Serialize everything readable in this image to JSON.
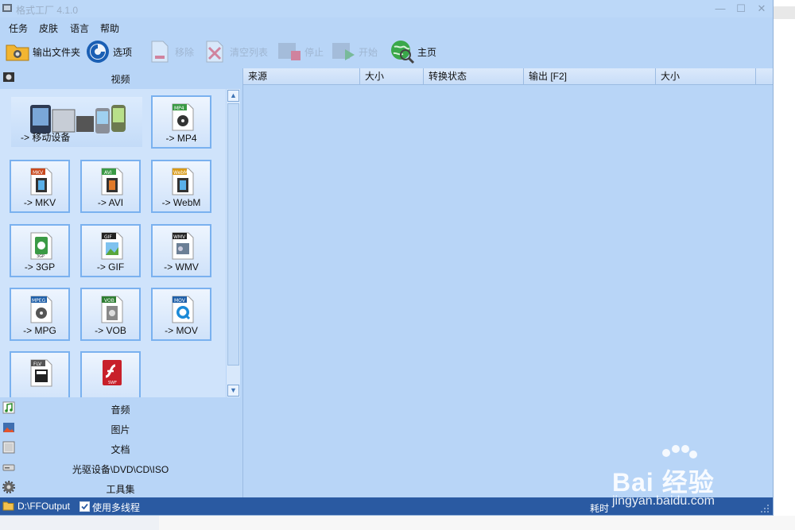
{
  "window": {
    "title": "格式工厂 4.1.0"
  },
  "menu": [
    "任务",
    "皮肤",
    "语言",
    "帮助"
  ],
  "toolbar": {
    "output_folder": "输出文件夹",
    "options": "选项",
    "remove": "移除",
    "clear_list": "清空列表",
    "stop": "停止",
    "start": "开始",
    "home": "主页"
  },
  "categories": {
    "video": "视频",
    "audio": "音频",
    "image": "图片",
    "document": "文档",
    "optical": "光驱设备\\DVD\\CD\\ISO",
    "tools": "工具集"
  },
  "tiles": {
    "mobile": "-> 移动设备",
    "mp4": "-> MP4",
    "mkv": "-> MKV",
    "avi": "-> AVI",
    "webm": "-> WebM",
    "3gp": "-> 3GP",
    "gif": "-> GIF",
    "wmv": "-> WMV",
    "mpg": "-> MPG",
    "vob": "-> VOB",
    "mov": "-> MOV"
  },
  "tile_badges": {
    "mp4": "MP4",
    "mkv": "MKV",
    "avi": "AVI",
    "webm": "WebM",
    "3gp": "3GP",
    "gif": "GIF",
    "wmv": "WMV",
    "mpeg": "MPEG",
    "vob": "VOB",
    "mov": "MOV",
    "flv": "FLV",
    "swf": "SWF"
  },
  "table": {
    "columns": [
      "来源",
      "大小",
      "转换状态",
      "输出 [F2]",
      "大小"
    ]
  },
  "status": {
    "output_path": "D:\\FFOutput",
    "multithread_label": "使用多线程",
    "elapsed_label": "耗时"
  },
  "watermark": {
    "brand": "Bai 经验",
    "url": "jingyan.baidu.com"
  },
  "colors": {
    "window_bg": "#b8d5f7",
    "status_bg": "#2a5aa2",
    "tile_border": "#7ab1ef"
  }
}
